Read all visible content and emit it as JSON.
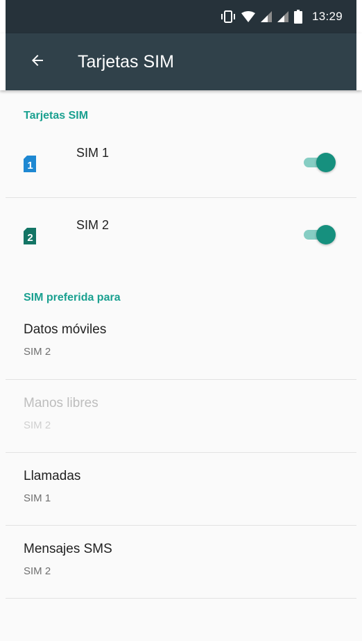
{
  "status_bar": {
    "time": "13:29",
    "icons": [
      "vibrate-icon",
      "wifi-icon",
      "signal-sim1-icon",
      "signal-sim2-icon",
      "battery-icon"
    ]
  },
  "app_bar": {
    "title": "Tarjetas SIM",
    "back_icon": "arrow-back-icon"
  },
  "sim_section": {
    "header": "Tarjetas SIM",
    "items": [
      {
        "badge": "1",
        "label": "SIM 1",
        "enabled": true,
        "badge_color": "#1e88d2"
      },
      {
        "badge": "2",
        "label": "SIM 2",
        "enabled": true,
        "badge_color": "#137565"
      }
    ]
  },
  "preferred_section": {
    "header": "SIM preferida para",
    "items": [
      {
        "title": "Datos móviles",
        "value": "SIM 2",
        "disabled": false
      },
      {
        "title": "Manos libres",
        "value": "SIM 2",
        "disabled": true
      },
      {
        "title": "Llamadas",
        "value": "SIM 1",
        "disabled": false
      },
      {
        "title": "Mensajes SMS",
        "value": "SIM 2",
        "disabled": false
      }
    ]
  },
  "colors": {
    "accent": "#1aa090",
    "toggle_thumb": "#16907e",
    "toggle_track": "#86cdc3",
    "app_bar": "#30414a",
    "status_bar": "#26323a"
  }
}
